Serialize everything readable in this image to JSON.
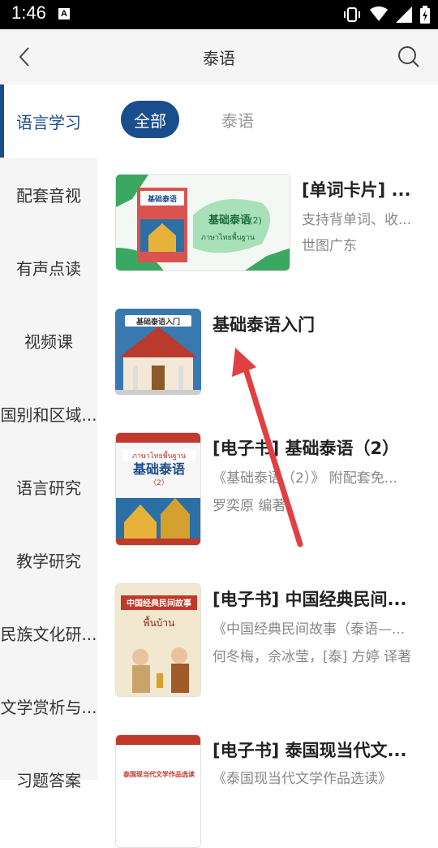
{
  "status": {
    "time": "1:46"
  },
  "header": {
    "title": "泰语"
  },
  "sidebar": {
    "items": [
      {
        "label": "语言学习"
      },
      {
        "label": "配套音视"
      },
      {
        "label": "有声点读"
      },
      {
        "label": "视频课"
      },
      {
        "label": "国别和区域..."
      },
      {
        "label": "语言研究"
      },
      {
        "label": "教学研究"
      },
      {
        "label": "民族文化研..."
      },
      {
        "label": "文学赏析与..."
      },
      {
        "label": "习题答案"
      }
    ]
  },
  "filters": {
    "all": "全部",
    "thai": "泰语"
  },
  "books": [
    {
      "title": "[单词卡片] ...",
      "desc": "支持背单词、收...",
      "author": "世图广东",
      "cover_text1": "基础泰语",
      "cover_text2": "(2)",
      "cover_text3": "ภาษาไทยพื้นฐาน"
    },
    {
      "title": "基础泰语入门",
      "cover_text1": "基础泰语入门"
    },
    {
      "title": "[电子书] 基础泰语（2）",
      "desc": "《基础泰语（2）》 附配套免...",
      "author": "罗奕原 编著",
      "cover_text1": "ภาษาไทยพื้นฐาน",
      "cover_text2": "基础泰语",
      "cover_text3": "（2）"
    },
    {
      "title": "[电子书] 中国经典民间...",
      "desc": "《中国经典民间故事（泰语—...",
      "author": "何冬梅，佘冰莹，[泰] 方婷 译著",
      "cover_text1": "中国经典民间故事",
      "cover_text2": "พื้นบ้าน"
    },
    {
      "title": "[电子书] 泰国现当代文...",
      "desc": "《泰国现当代文学作品选读》",
      "cover_text1": "泰国现当代文学作品选读"
    }
  ],
  "colors": {
    "accent": "#1a4d8c",
    "annotation": "#e04040"
  }
}
